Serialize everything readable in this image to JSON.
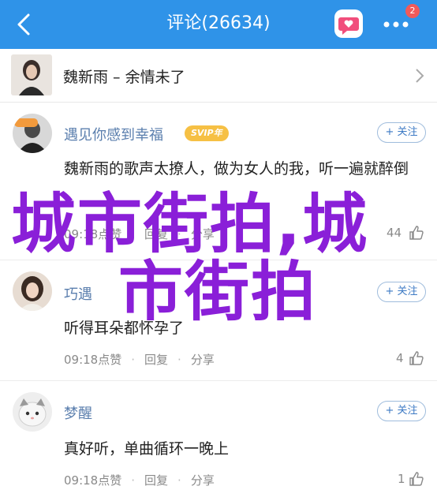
{
  "header": {
    "title": "评论(26634)",
    "badge_count": "2",
    "accent": "#2f93e8"
  },
  "song": {
    "label": "魏新雨 – 余情未了"
  },
  "comments": [
    {
      "user": "遇见你感到幸福",
      "vip": "SVIP年",
      "text": "魏新雨的歌声太撩人，做为女人的我，听一遍就醉倒",
      "time": "09:18",
      "like_count": "44",
      "follow_label": "+ 关注"
    },
    {
      "user": "巧遇",
      "text": "听得耳朵都怀孕了",
      "time": "09:18",
      "like_count": "4",
      "follow_label": "+ 关注"
    },
    {
      "user": "梦醒",
      "text": "真好听，单曲循环一晚上",
      "time": "09:18",
      "like_count": "1",
      "follow_label": "+ 关注"
    }
  ],
  "actions": {
    "like": "点赞",
    "reply": "回复",
    "share": "分享"
  },
  "watermark": {
    "line1": "城市街拍,城",
    "line2": "市街拍"
  }
}
